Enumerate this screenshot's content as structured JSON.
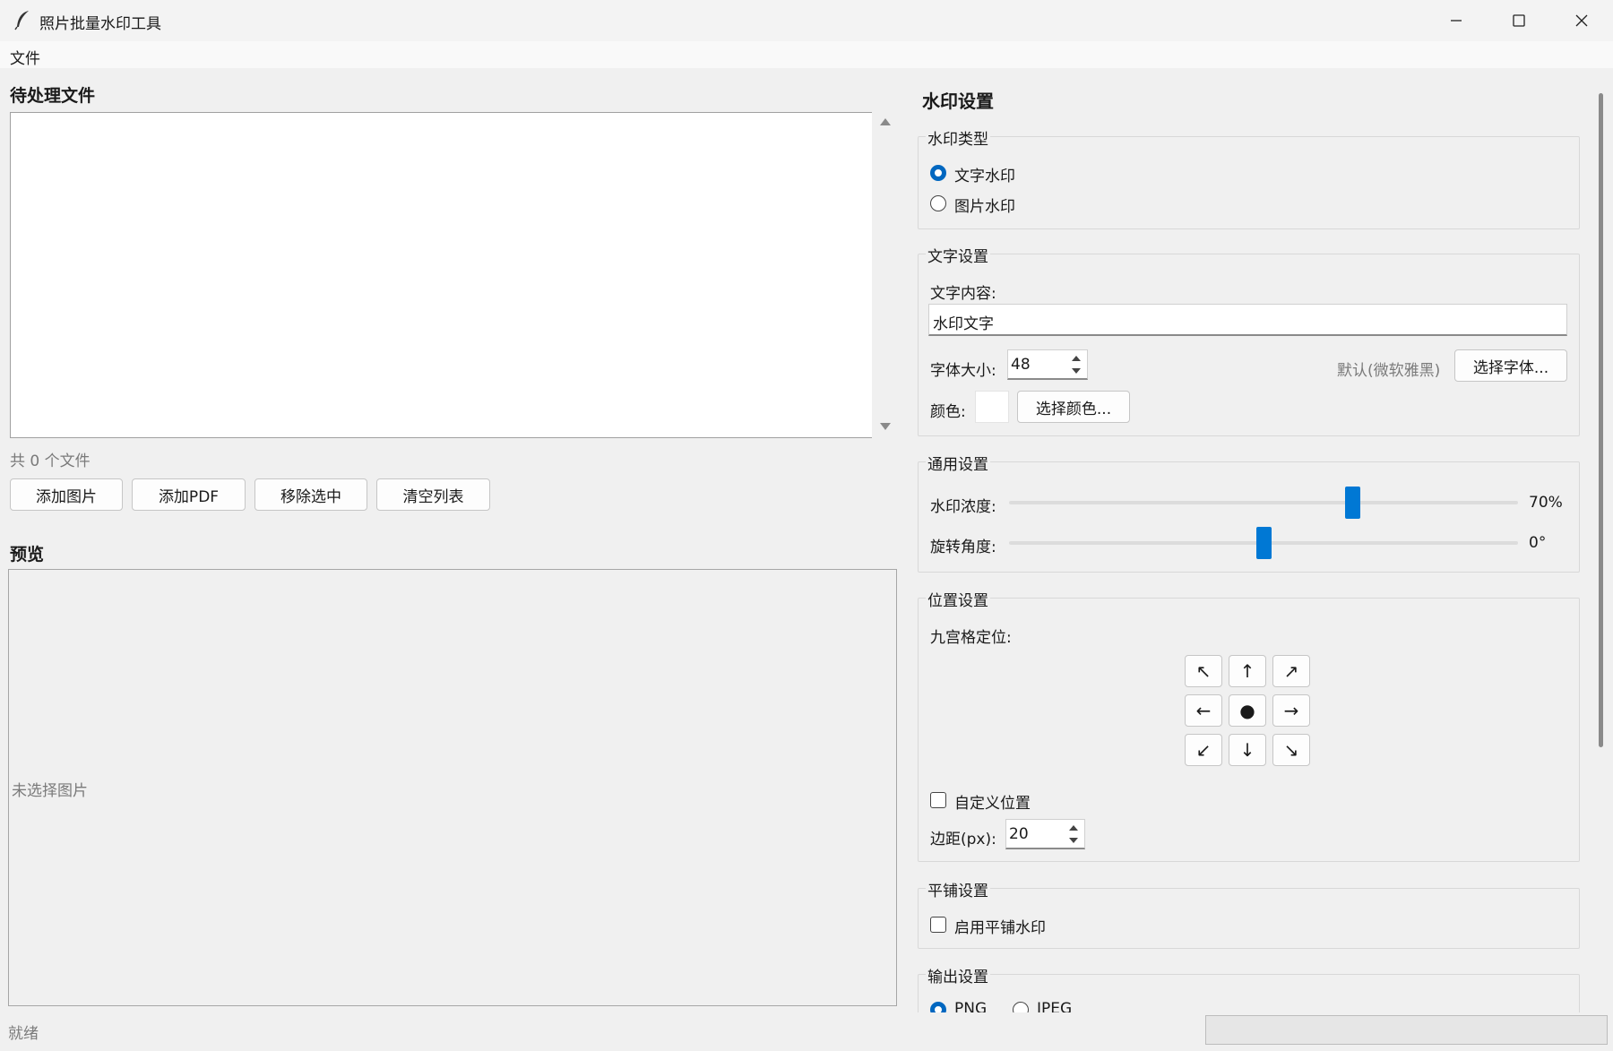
{
  "window": {
    "title": "照片批量水印工具"
  },
  "menu": {
    "file": "文件"
  },
  "files": {
    "header": "待处理文件",
    "count_text": "共 0 个文件",
    "buttons": {
      "add_images": "添加图片",
      "add_pdf": "添加PDF",
      "remove_selected": "移除选中",
      "clear_list": "清空列表"
    }
  },
  "preview": {
    "header": "预览",
    "placeholder": "未选择图片"
  },
  "settings": {
    "header": "水印设置",
    "type": {
      "label": "水印类型",
      "options": [
        "文字水印",
        "图片水印"
      ],
      "selected": "文字水印"
    },
    "text": {
      "label": "文字设置",
      "content_label": "文字内容:",
      "content_value": "水印文字",
      "size_label": "字体大小:",
      "size_value": "48",
      "font_default": "默认(微软雅黑)",
      "choose_font": "选择字体...",
      "color_label": "颜色:",
      "color_value": "#ffffff",
      "choose_color": "选择颜色..."
    },
    "general": {
      "label": "通用设置",
      "opacity_label": "水印浓度:",
      "opacity_value": "70%",
      "opacity_level": 0.68,
      "rotation_label": "旋转角度:",
      "rotation_value": "0°",
      "rotation_level": 0.5
    },
    "position": {
      "label": "位置设置",
      "grid_label": "九宫格定位:",
      "grid": [
        "↖",
        "↑",
        "↗",
        "←",
        "●",
        "→",
        "↙",
        "↓",
        "↘"
      ],
      "custom_label": "自定义位置",
      "margin_label": "边距(px):",
      "margin_value": "20"
    },
    "tile": {
      "label": "平铺设置",
      "enable_label": "启用平铺水印"
    },
    "output": {
      "label": "输出设置",
      "formats": [
        "PNG",
        "JPEG"
      ],
      "selected": "PNG"
    }
  },
  "status": {
    "text": "就绪",
    "progress": 0
  },
  "colors": {
    "accent": "#0067c0",
    "slider": "#0078d4"
  }
}
